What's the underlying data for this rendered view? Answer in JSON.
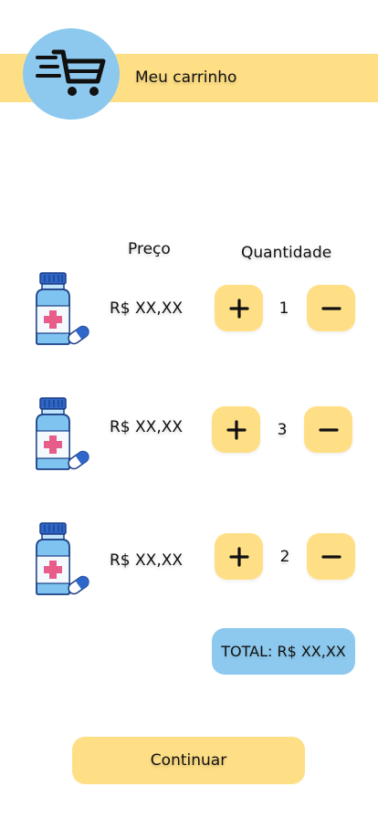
{
  "header": {
    "title": "Meu carrinho",
    "logo_icon": "shopping-cart-fast-icon"
  },
  "colors": {
    "accent_yellow": "#FFDF86",
    "accent_blue": "#8DC9EE"
  },
  "columns": {
    "price": "Preço",
    "quantity": "Quantidade"
  },
  "items": [
    {
      "icon": "medicine-bottle-icon",
      "price": "R$ XX,XX",
      "quantity": "1"
    },
    {
      "icon": "medicine-bottle-icon",
      "price": "R$ XX,XX",
      "quantity": "3"
    },
    {
      "icon": "medicine-bottle-icon",
      "price": "R$ XX,XX",
      "quantity": "2"
    }
  ],
  "controls": {
    "increment_icon": "plus-icon",
    "decrement_icon": "minus-icon"
  },
  "total": {
    "label": "TOTAL: R$ XX,XX"
  },
  "actions": {
    "continue_label": "Continuar"
  }
}
